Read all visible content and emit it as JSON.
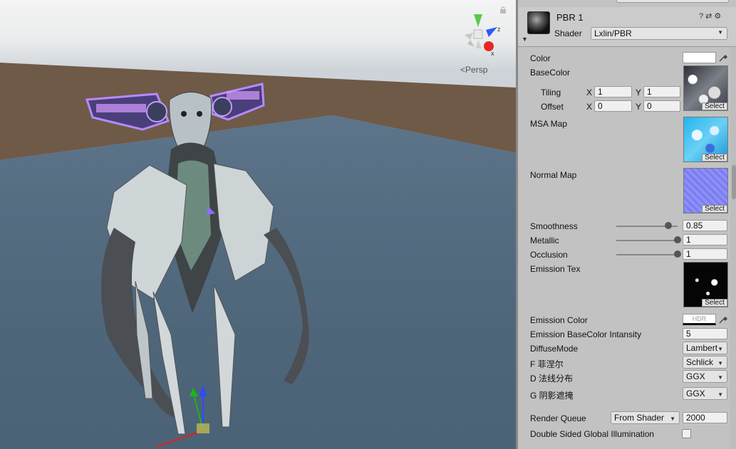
{
  "scene": {
    "projection_label": "Persp",
    "gizmo_labels": {
      "z": "z",
      "x": "x"
    }
  },
  "material": {
    "name": "PBR 1",
    "shader_label": "Shader",
    "shader_value": "Lxlin/PBR"
  },
  "properties": {
    "color": "Color",
    "base_color": "BaseColor",
    "tiling": "Tiling",
    "offset": "Offset",
    "x_label": "X",
    "y_label": "Y",
    "tiling_x": "1",
    "tiling_y": "1",
    "offset_x": "0",
    "offset_y": "0",
    "msa_map": "MSA Map",
    "normal_map": "Normal Map",
    "smoothness": "Smoothness",
    "smoothness_value": "0.85",
    "metallic": "Metallic",
    "metallic_value": "1",
    "occlusion": "Occlusion",
    "occlusion_value": "1",
    "emission_tex": "Emission Tex",
    "emission_color": "Emission Color",
    "hdr": "HDR",
    "emission_intensity": "Emission BaseColor Intansity",
    "emission_intensity_value": "5",
    "diffuse_mode": "DiffuseMode",
    "diffuse_mode_value": "Lambert",
    "fresnel": "F 菲涅尔",
    "fresnel_value": "Schlick",
    "ndf": "D 法线分布",
    "ndf_value": "GGX",
    "geometry": "G 阴影遮掩",
    "geometry_value": "GGX",
    "render_queue": "Render Queue",
    "render_queue_mode": "From Shader",
    "render_queue_value": "2000",
    "double_sided_gi": "Double Sided Global Illumination",
    "select": "Select"
  },
  "slider_levels": {
    "smoothness": 0.85,
    "metallic": 1,
    "occlusion": 1
  },
  "colors": {
    "ground": "#4d6478",
    "dirt": "#6e5846",
    "glow": "#9a6cff"
  }
}
